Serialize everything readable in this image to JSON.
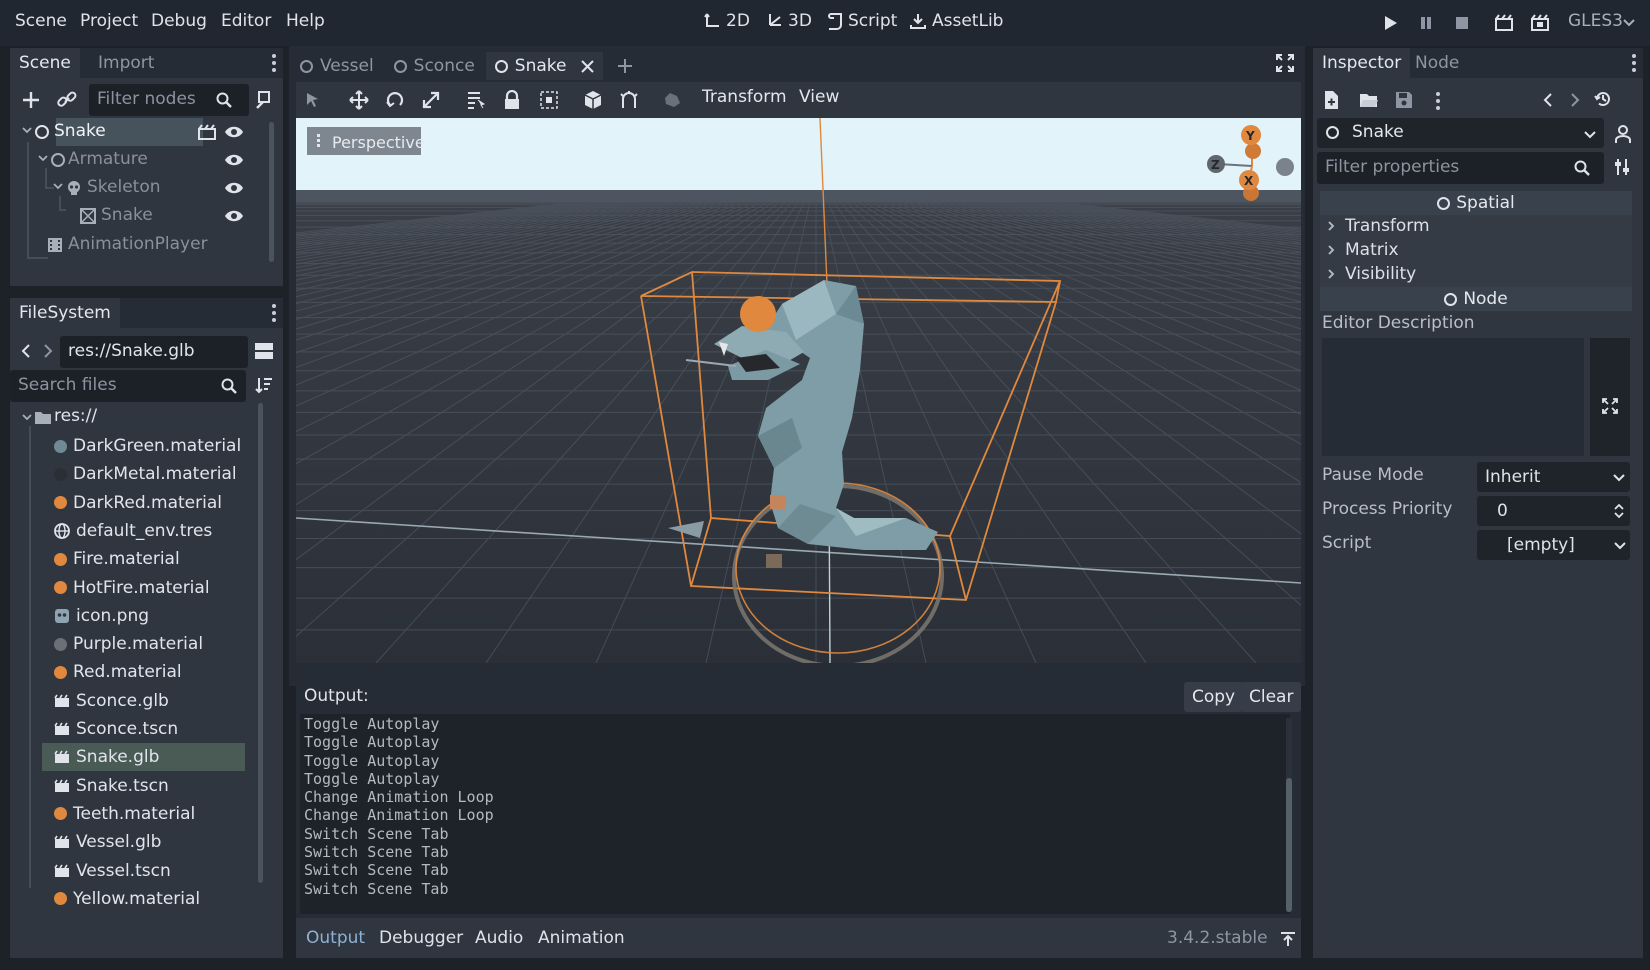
{
  "menu": [
    "Scene",
    "Project",
    "Debug",
    "Editor",
    "Help"
  ],
  "modes": {
    "two_d": "2D",
    "three_d": "3D",
    "script": "Script",
    "assetlib": "AssetLib"
  },
  "renderer": "GLES3",
  "scene_panel": {
    "tabs": [
      "Scene",
      "Import"
    ],
    "filter_placeholder": "Filter nodes",
    "tree": [
      {
        "label": "Snake"
      },
      {
        "label": "Armature"
      },
      {
        "label": "Skeleton"
      },
      {
        "label": "Snake"
      },
      {
        "label": "AnimationPlayer"
      }
    ]
  },
  "filesystem": {
    "tab": "FileSystem",
    "path": "res://Snake.glb",
    "search_placeholder": "Search files",
    "root": "res://",
    "files": [
      {
        "name": "DarkGreen.material",
        "color": "#6f8a93",
        "kind": "material"
      },
      {
        "name": "DarkMetal.material",
        "color": "#2a2f36",
        "kind": "material"
      },
      {
        "name": "DarkRed.material",
        "color": "#e0893e",
        "kind": "material"
      },
      {
        "name": "default_env.tres",
        "color": "#dfe3ea",
        "kind": "globe"
      },
      {
        "name": "Fire.material",
        "color": "#e0893e",
        "kind": "material"
      },
      {
        "name": "HotFire.material",
        "color": "#e0893e",
        "kind": "material"
      },
      {
        "name": "icon.png",
        "color": "#8ea3b3",
        "kind": "image"
      },
      {
        "name": "Purple.material",
        "color": "#6b6f76",
        "kind": "material"
      },
      {
        "name": "Red.material",
        "color": "#e0893e",
        "kind": "material"
      },
      {
        "name": "Sconce.glb",
        "color": "#dfe3ea",
        "kind": "scene"
      },
      {
        "name": "Sconce.tscn",
        "color": "#dfe3ea",
        "kind": "scene"
      },
      {
        "name": "Snake.glb",
        "color": "#dfe3ea",
        "kind": "scene"
      },
      {
        "name": "Snake.tscn",
        "color": "#dfe3ea",
        "kind": "scene"
      },
      {
        "name": "Teeth.material",
        "color": "#e0893e",
        "kind": "material"
      },
      {
        "name": "Vessel.glb",
        "color": "#dfe3ea",
        "kind": "scene"
      },
      {
        "name": "Vessel.tscn",
        "color": "#dfe3ea",
        "kind": "scene"
      },
      {
        "name": "Yellow.material",
        "color": "#e0893e",
        "kind": "material"
      }
    ]
  },
  "editor_tabs": [
    "Vessel",
    "Sconce",
    "Snake"
  ],
  "viewport_toolbar": {
    "transform": "Transform",
    "view": "View"
  },
  "viewport": {
    "perspective": "Perspective",
    "gizmo": {
      "y": "Y",
      "z": "Z",
      "x": "X"
    }
  },
  "output": {
    "title": "Output:",
    "copy": "Copy",
    "clear": "Clear",
    "lines": [
      "Toggle Autoplay",
      "Toggle Autoplay",
      "Toggle Autoplay",
      "Toggle Autoplay",
      "Change Animation Loop",
      "Change Animation Loop",
      "Switch Scene Tab",
      "Switch Scene Tab",
      "Switch Scene Tab",
      "Switch Scene Tab"
    ],
    "bottom_tabs": [
      "Output",
      "Debugger",
      "Audio",
      "Animation"
    ],
    "version": "3.4.2.stable"
  },
  "inspector": {
    "tabs": [
      "Inspector",
      "Node"
    ],
    "node_name": "Snake",
    "filter_placeholder": "Filter properties",
    "section_spatial": "Spatial",
    "groups": [
      "Transform",
      "Matrix",
      "Visibility"
    ],
    "section_node": "Node",
    "editor_description": "Editor Description",
    "properties": [
      {
        "label": "Pause Mode",
        "value": "Inherit"
      },
      {
        "label": "Process Priority",
        "value": "0"
      },
      {
        "label": "Script",
        "value": "[empty]"
      }
    ]
  }
}
